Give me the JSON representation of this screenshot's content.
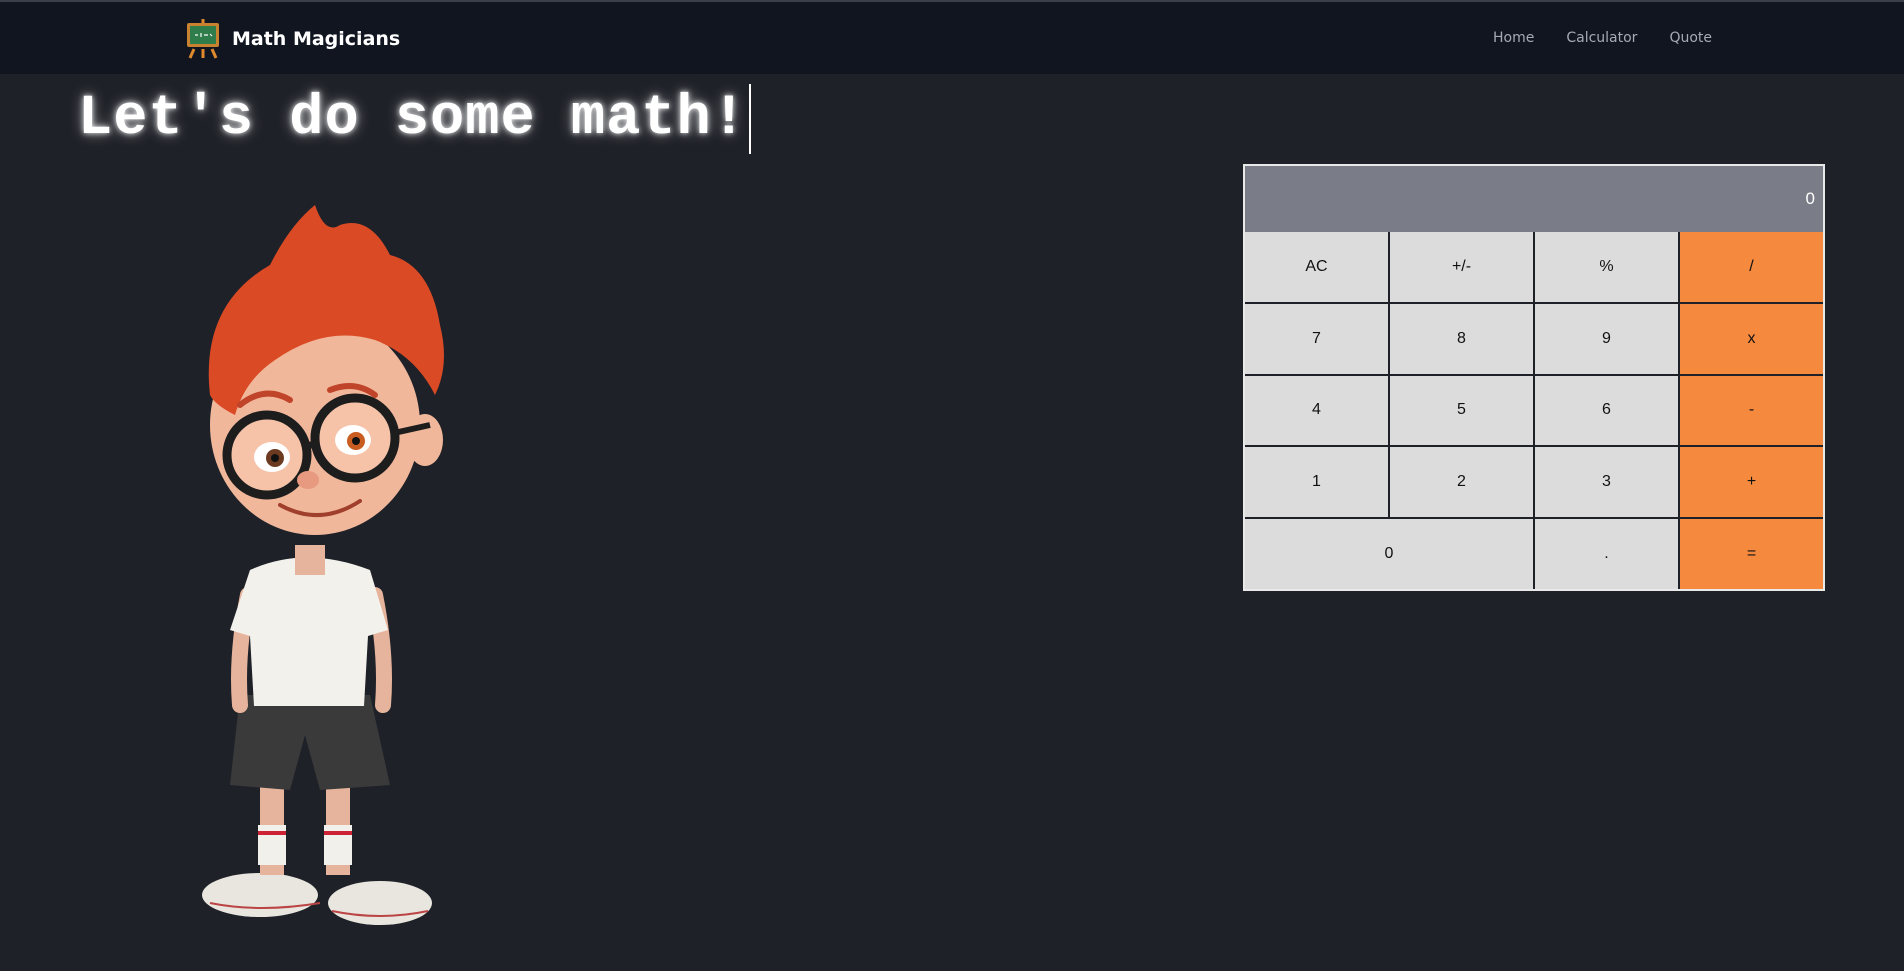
{
  "navbar": {
    "brand": "Math Magicians",
    "links": [
      "Home",
      "Calculator",
      "Quote"
    ]
  },
  "headline": "Let's do some math!",
  "calculator": {
    "display": "0",
    "keys": [
      {
        "label": "AC",
        "type": "fn"
      },
      {
        "label": "+/-",
        "type": "fn"
      },
      {
        "label": "%",
        "type": "fn"
      },
      {
        "label": "/",
        "type": "op"
      },
      {
        "label": "7",
        "type": "num"
      },
      {
        "label": "8",
        "type": "num"
      },
      {
        "label": "9",
        "type": "num"
      },
      {
        "label": "x",
        "type": "op"
      },
      {
        "label": "4",
        "type": "num"
      },
      {
        "label": "5",
        "type": "num"
      },
      {
        "label": "6",
        "type": "num"
      },
      {
        "label": "-",
        "type": "op"
      },
      {
        "label": "1",
        "type": "num"
      },
      {
        "label": "2",
        "type": "num"
      },
      {
        "label": "3",
        "type": "num"
      },
      {
        "label": "+",
        "type": "op"
      },
      {
        "label": "0",
        "type": "num"
      },
      {
        "label": ".",
        "type": "num"
      },
      {
        "label": "=",
        "type": "op"
      }
    ]
  },
  "colors": {
    "background": "#1f2128",
    "navbar": "#101520",
    "operator": "#f58a3f",
    "key": "#dcdcdc",
    "display": "#7a7c87"
  },
  "icons": {
    "brand": "chalkboard-easel-icon"
  }
}
